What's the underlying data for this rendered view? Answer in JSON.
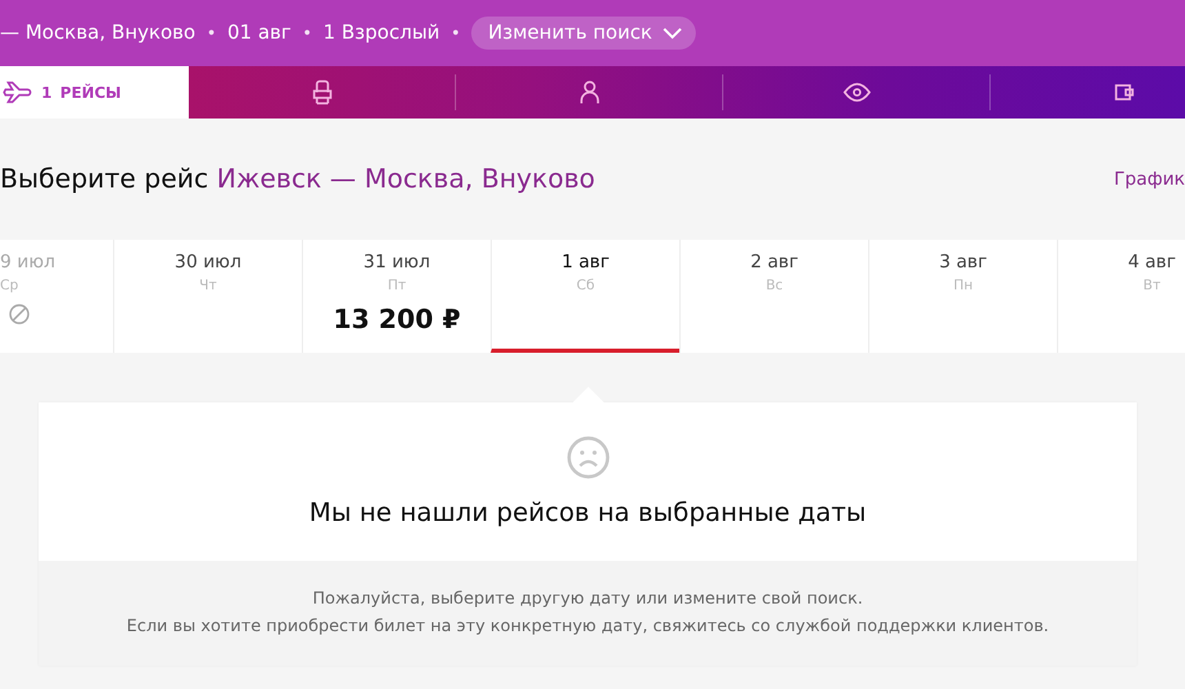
{
  "header": {
    "route": "— Москва, Внуково",
    "date": "01 авг",
    "passengers": "1 Взрослый",
    "change_button": "Изменить поиск",
    "separators": [
      "•",
      "•",
      "•"
    ]
  },
  "tabs": [
    {
      "kind": "flights",
      "number": "1",
      "label": "РЕЙСЫ",
      "selected": true
    },
    {
      "kind": "seat",
      "selected": false
    },
    {
      "kind": "person",
      "selected": false
    },
    {
      "kind": "eye",
      "selected": false
    },
    {
      "kind": "wallet",
      "selected": false
    }
  ],
  "heading": {
    "prefix": "Выберите рейс",
    "route": "Ижевск — Москва, Внуково",
    "link": "График"
  },
  "dates": [
    {
      "date": "9 июл",
      "weekday": "Ср",
      "unavailable": true,
      "selected": false
    },
    {
      "date": "30 июл",
      "weekday": "Чт",
      "unavailable": false,
      "selected": false
    },
    {
      "date": "31 июл",
      "weekday": "Пт",
      "price": "13 200 ₽",
      "unavailable": false,
      "selected": false
    },
    {
      "date": "1 авг",
      "weekday": "Сб",
      "unavailable": false,
      "selected": true
    },
    {
      "date": "2 авг",
      "weekday": "Вс",
      "unavailable": false,
      "selected": false
    },
    {
      "date": "3 авг",
      "weekday": "Пн",
      "unavailable": false,
      "selected": false
    },
    {
      "date": "4 авг",
      "weekday": "Вт",
      "unavailable": false,
      "selected": false
    }
  ],
  "notice": {
    "title": "Мы не нашли рейсов на выбранные даты",
    "lines": [
      "Пожалуйста, выберите другую дату или измените свой поиск.",
      "Если вы хотите приобрести билет на эту конкретную дату, свяжитесь со службой поддержки клиентов."
    ]
  }
}
